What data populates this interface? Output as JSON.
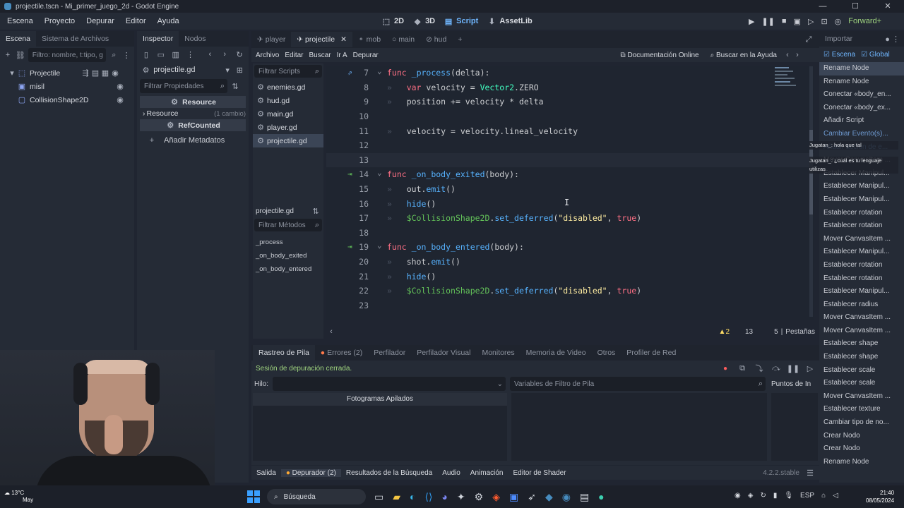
{
  "window": {
    "title": "projectile.tscn - Mi_primer_juego_2d - Godot Engine",
    "controls": [
      "—",
      "☐",
      "✕"
    ]
  },
  "menu": [
    "Escena",
    "Proyecto",
    "Depurar",
    "Editor",
    "Ayuda"
  ],
  "workspaces": [
    {
      "label": "2D",
      "icon": "2d-icon"
    },
    {
      "label": "3D",
      "icon": "3d-icon"
    },
    {
      "label": "Script",
      "icon": "script-icon"
    },
    {
      "label": "AssetLib",
      "icon": "assetlib-icon"
    }
  ],
  "renderer": "Forward+",
  "scene_dock": {
    "tabs": [
      "Escena",
      "Sistema de Archivos"
    ],
    "filter_placeholder": "Filtro: nombre, t:tipo, g",
    "tree": [
      {
        "name": "Projectile",
        "icon": "area2d-icon"
      },
      {
        "name": "misil",
        "icon": "sprite-icon"
      },
      {
        "name": "CollisionShape2D",
        "icon": "collision-icon"
      }
    ]
  },
  "inspector": {
    "tabs": [
      "Inspector",
      "Nodos"
    ],
    "resource_name": "projectile.gd",
    "filter_placeholder": "Filtrar Propiedades",
    "section_resource": "Resource",
    "sub_resource": "Resource",
    "sub_resource_note": "(1 cambio)",
    "section_refcounted": "RefCounted",
    "add_metadata": "Añadir Metadatos"
  },
  "editor_tabs": [
    {
      "label": "player"
    },
    {
      "label": "projectile",
      "active": true
    },
    {
      "label": "mob"
    },
    {
      "label": "main"
    },
    {
      "label": "hud"
    }
  ],
  "script_menu": [
    "Archivo",
    "Editar",
    "Buscar",
    "Ir A",
    "Depurar"
  ],
  "script_help": {
    "online_docs": "Documentación Online",
    "search_help": "Buscar en la Ayuda"
  },
  "scripts_panel": {
    "filter_placeholder": "Filtrar Scripts",
    "files": [
      "enemies.gd",
      "hud.gd",
      "main.gd",
      "player.gd",
      "projectile.gd"
    ],
    "current": "projectile.gd",
    "methods_filter": "Filtrar Métodos",
    "methods": [
      "_process",
      "_on_body_exited",
      "_on_body_entered"
    ]
  },
  "code": {
    "lines": [
      {
        "n": "7",
        "html": "<span class='kw'>func</span> <span class='fn'>_process</span>(delta):"
      },
      {
        "n": "8",
        "html": "    <span class='kw'>var</span> velocity = <span class='ty'>Vector2</span>.ZERO"
      },
      {
        "n": "9",
        "html": "    position += velocity * delta"
      },
      {
        "n": "10",
        "html": ""
      },
      {
        "n": "11",
        "html": "    velocity = velocity.lineal_velocity"
      },
      {
        "n": "12",
        "html": ""
      },
      {
        "n": "13",
        "html": ""
      },
      {
        "n": "14",
        "html": "<span class='kw'>func</span> <span class='fn'>_on_body_exited</span>(body):"
      },
      {
        "n": "15",
        "html": "    out.<span class='fn'>emit</span>()"
      },
      {
        "n": "16",
        "html": "    <span class='fn'>hide</span>()"
      },
      {
        "n": "17",
        "html": "    <span class='nd'>$CollisionShape2D</span>.<span class='fn'>set_deferred</span>(<span class='st'>\"disabled\"</span>, <span class='bt'>true</span>)"
      },
      {
        "n": "18",
        "html": ""
      },
      {
        "n": "19",
        "html": "<span class='kw'>func</span> <span class='fn'>_on_body_entered</span>(body):"
      },
      {
        "n": "20",
        "html": "    shot.<span class='fn'>emit</span>()"
      },
      {
        "n": "21",
        "html": "    <span class='fn'>hide</span>()"
      },
      {
        "n": "22",
        "html": "    <span class='nd'>$CollisionShape2D</span>.<span class='fn'>set_deferred</span>(<span class='st'>\"disabled\"</span>, <span class='bt'>true</span>)"
      },
      {
        "n": "23",
        "html": ""
      }
    ],
    "status": {
      "warnings": "2",
      "line": "13",
      "col": "5",
      "indent": "Pestañas"
    }
  },
  "history_panel": {
    "tab_import": "Importar",
    "scope": [
      "Escena",
      "Global"
    ],
    "items": [
      "Rename Node",
      "Rename Node",
      "Conectar «body_en...",
      "Conectar «body_ex...",
      "Añadir Script",
      "Cambiar Evento(s)...",
      "Añadir acción de e...",
      "Mover CanvasItem ...",
      "Establecer Manipul...",
      "Establecer Manipul...",
      "Establecer Manipul...",
      "Establecer rotation",
      "Establecer rotation",
      "Mover CanvasItem ...",
      "Establecer Manipul...",
      "Establecer rotation",
      "Establecer rotation",
      "Establecer Manipul...",
      "Establecer radius",
      "Mover CanvasItem ...",
      "Mover CanvasItem ...",
      "Establecer shape",
      "Establecer shape",
      "Establecer scale",
      "Establecer scale",
      "Mover CanvasItem ...",
      "Establecer texture",
      "Cambiar tipo de no...",
      "Crear Nodo",
      "Crear Nodo",
      "Rename Node"
    ]
  },
  "chat": [
    "Jugatan_: hola que tal",
    "Jugatan_: ¿cuál es tu lenguaje utilizas"
  ],
  "debugger": {
    "tabs": [
      "Rastreo de Pila",
      "Errores (2)",
      "Perfilador",
      "Perfilador Visual",
      "Monitores",
      "Memoria de Video",
      "Otros",
      "Profiler de Red"
    ],
    "message": "Sesión de depuración cerrada.",
    "thread_label": "Hilo:",
    "stack_frames": "Fotogramas Apilados",
    "stack_filter": "Variables de Filtro de Pila",
    "breakpoints": "Puntos de In"
  },
  "bottom_bar": {
    "items": [
      "Salida",
      "Depurador (2)",
      "Resultados de la Búsqueda",
      "Audio",
      "Animación",
      "Editor de Shader"
    ],
    "version": "4.2.2.stable"
  },
  "taskbar": {
    "weather": "13°C",
    "weather_sub": "May",
    "search": "Búsqueda",
    "lang": "ESP",
    "time": "21:40",
    "date": "08/05/2024"
  }
}
